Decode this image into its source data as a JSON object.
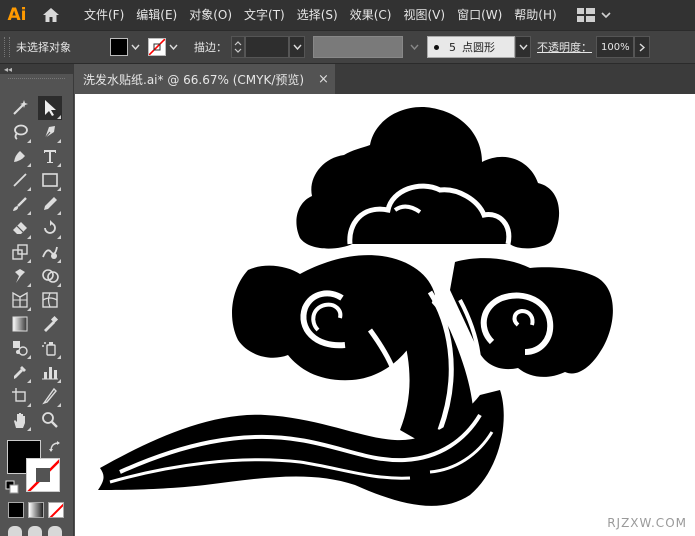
{
  "app": {
    "logo": "Ai"
  },
  "menu": {
    "items": [
      "文件(F)",
      "编辑(E)",
      "对象(O)",
      "文字(T)",
      "选择(S)",
      "效果(C)",
      "视图(V)",
      "窗口(W)",
      "帮助(H)"
    ]
  },
  "control": {
    "selection_state": "未选择对象",
    "stroke_label": "描边：",
    "brush_size": "5",
    "brush_name": "点圆形",
    "opacity_label": "不透明度：",
    "opacity_value": "100%"
  },
  "document": {
    "tab_title": "洗发水贴纸.ai* @ 66.67% (CMYK/预览)",
    "close_glyph": "×"
  },
  "watermark": "RJZXW.COM",
  "colors": {
    "accent": "#ff9a00",
    "fill": "#000000",
    "stroke_none": "#ff0000"
  },
  "icons": {
    "tools": [
      "magic-wand-icon",
      "selection-arrow-icon",
      "lasso-icon",
      "pen-icon",
      "curvature-icon",
      "type-icon",
      "line-icon",
      "rectangle-icon",
      "paintbrush-icon",
      "pencil-icon",
      "eraser-icon",
      "rotate-icon",
      "scale-icon",
      "warp-icon",
      "puppet-warp-icon",
      "shape-builder-icon",
      "perspective-grid-icon",
      "mesh-icon",
      "gradient-icon",
      "eyedropper-icon",
      "blend-icon",
      "symbol-sprayer-icon",
      "graph-icon",
      "artboard-icon",
      "slice-icon",
      "hand-icon",
      "zoom-icon"
    ]
  }
}
